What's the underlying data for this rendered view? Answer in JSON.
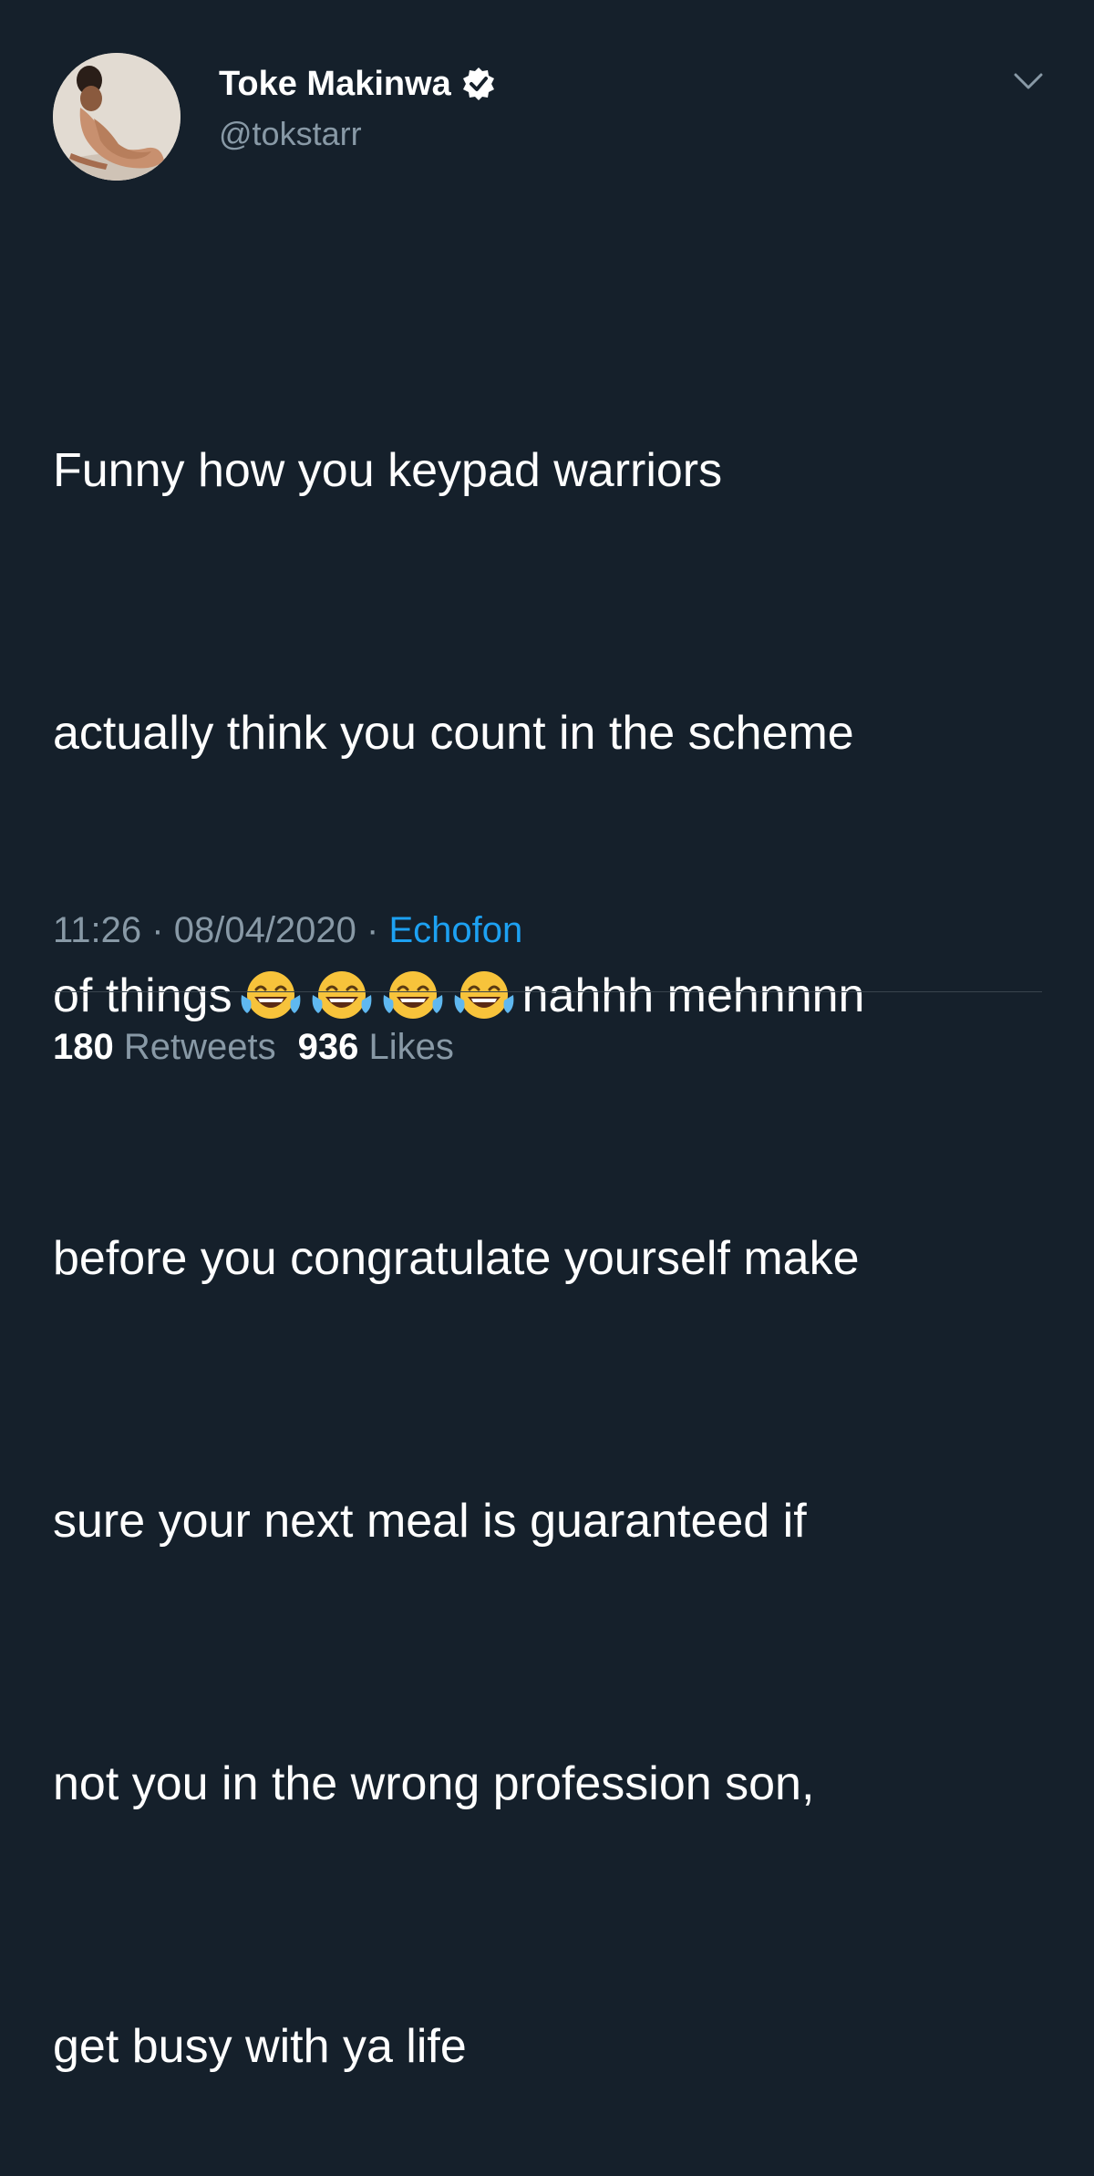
{
  "author": {
    "display_name": "Toke Makinwa",
    "handle": "@tokstarr",
    "verified": true,
    "avatar_icon": "profile-photo"
  },
  "menu_icon": "chevron-down-icon",
  "tweet": {
    "lines": [
      "Funny how you keypad warriors",
      "actually think you count in the scheme",
      "of things",
      "nahhh mehnnnn",
      "before you congratulate yourself make",
      "sure your next meal is guaranteed if",
      "not you in the wrong profession son,",
      "get busy with ya life"
    ],
    "emoji": [
      "😂",
      "😂",
      "😂",
      "😂"
    ]
  },
  "meta": {
    "time": "11:26",
    "separator": "·",
    "date": "08/04/2020",
    "source": "Echofon"
  },
  "stats": {
    "retweets_count": "180",
    "retweets_label": "Retweets",
    "likes_count": "936",
    "likes_label": "Likes"
  },
  "colors": {
    "background": "#15202b",
    "text": "#ffffff",
    "secondary": "#8899a6",
    "link": "#1da1f2",
    "divider": "#38444d"
  }
}
